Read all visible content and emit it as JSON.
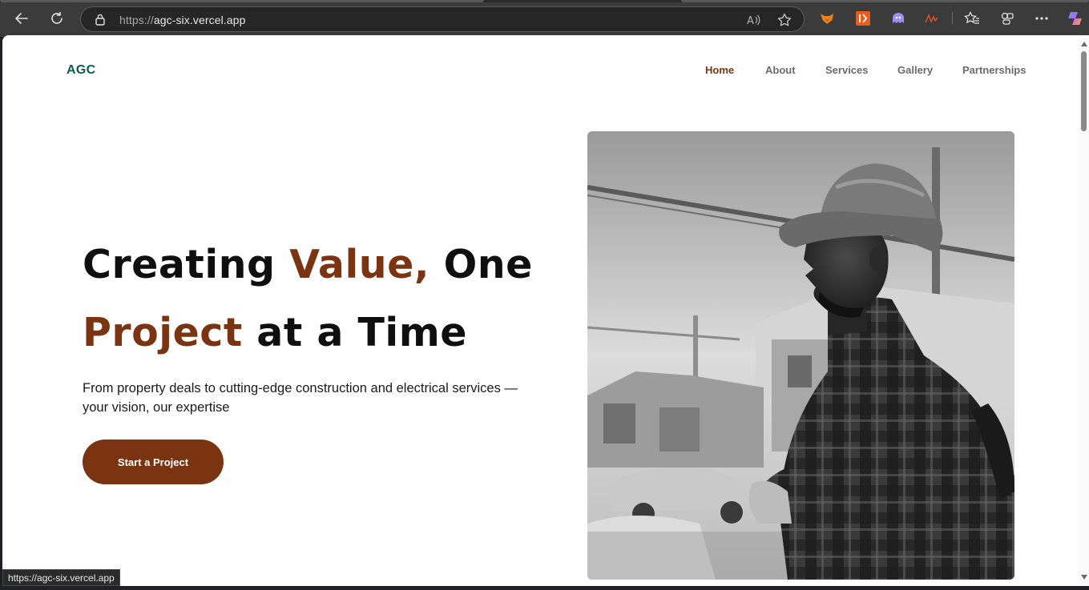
{
  "browser": {
    "url_scheme": "https://",
    "url_host": "agc-six.vercel.app",
    "status_url": "https://agc-six.vercel.app",
    "icons": {
      "back": "back-arrow-icon",
      "reload": "reload-icon",
      "site_info": "lock-icon",
      "read_aloud": "read-aloud-icon",
      "favorite": "star-icon",
      "ext1": "fox-extension-icon",
      "ext2": "orange-extension-icon",
      "ext3": "ghost-extension-icon",
      "ext4": "signature-extension-icon",
      "favorites": "favorites-icon",
      "collections": "collections-icon",
      "more": "more-icon",
      "copilot": "copilot-icon"
    }
  },
  "site": {
    "logo": "AGC",
    "nav": [
      {
        "label": "Home",
        "active": true
      },
      {
        "label": "About",
        "active": false
      },
      {
        "label": "Services",
        "active": false
      },
      {
        "label": "Gallery",
        "active": false
      },
      {
        "label": "Partnerships",
        "active": false
      }
    ],
    "hero": {
      "title_part1": "Creating ",
      "title_accent1": "Value,",
      "title_part2": " One",
      "title_accent2": "Project",
      "title_part3": " at a Time",
      "subtitle": "From property deals to cutting-edge construction and electrical services — your vision, our expertise",
      "cta_label": "Start a Project",
      "photo_subject": "construction-worker-in-hard-hat"
    }
  },
  "colors": {
    "brand_green": "#0e5c45",
    "accent_brown": "#7a3411",
    "text_dark": "#0f0f0f",
    "nav_gray": "#6b6b6b"
  }
}
